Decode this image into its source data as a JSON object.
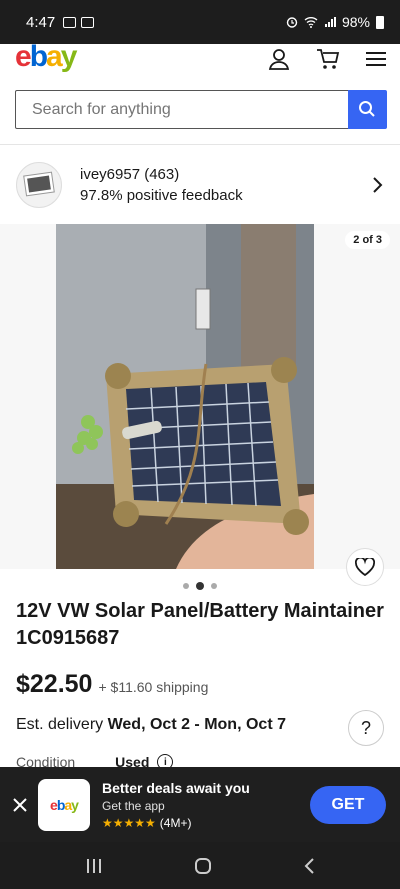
{
  "status_bar": {
    "time": "4:47",
    "battery": "98%"
  },
  "header": {
    "logo_letters": [
      "e",
      "b",
      "a",
      "y"
    ],
    "logo_colors": [
      "#e53238",
      "#0064d2",
      "#f5af02",
      "#86b817"
    ],
    "icons": [
      "account-icon",
      "cart-icon",
      "menu-icon"
    ]
  },
  "search": {
    "placeholder": "Search for anything"
  },
  "seller": {
    "name": "ivey6957 (463)",
    "feedback": "97.8% positive feedback"
  },
  "gallery": {
    "counter": "2 of 3",
    "current_index": 1,
    "total": 3
  },
  "listing": {
    "title": "12V VW Solar Panel/Battery Maintainer 1C0915687",
    "price": "$22.50",
    "shipping": "+ $11.60 shipping",
    "delivery_prefix": "Est. delivery ",
    "delivery_dates": "Wed, Oct 2 - Mon, Oct 7",
    "condition_label": "Condition",
    "condition_value": "Used"
  },
  "app_banner": {
    "title": "Better deals await you",
    "subtitle": "Get the app",
    "stars": "★★★★★",
    "rating_count": "(4M+)",
    "logo_text": "ebay",
    "cta": "GET"
  },
  "colors": {
    "accent": "#3665f3",
    "banner_bg": "#1f1f1f"
  }
}
